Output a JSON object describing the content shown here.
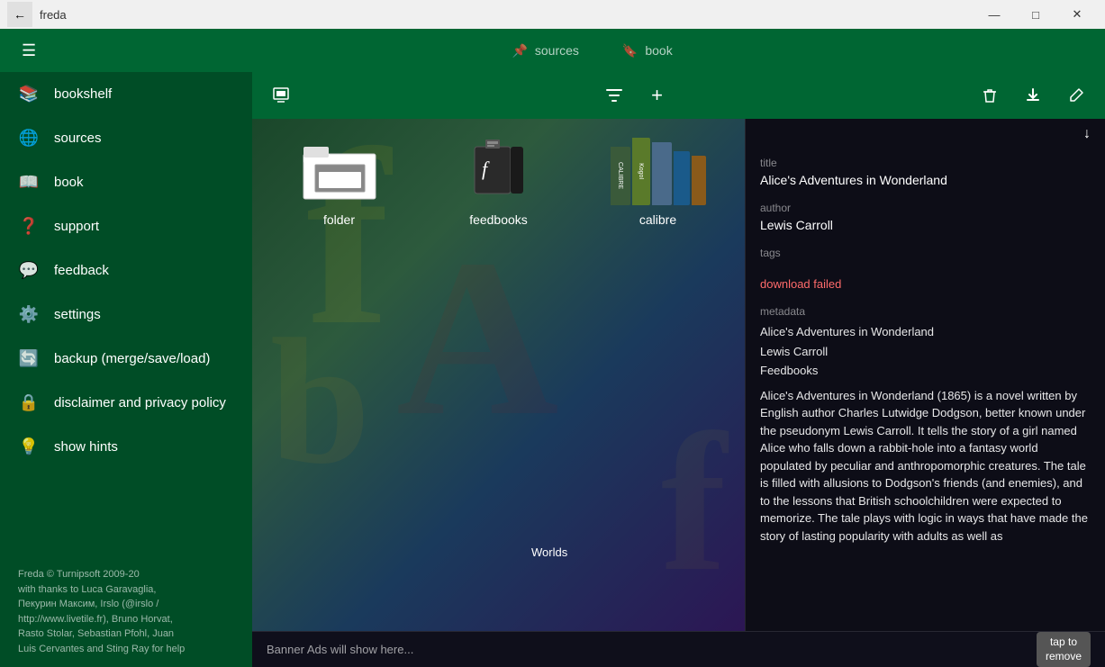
{
  "titlebar": {
    "title": "freda",
    "back_icon": "←",
    "minimize": "—",
    "maximize": "□",
    "close": "✕"
  },
  "topnav": {
    "hamburger": "☰",
    "tabs": [
      {
        "id": "sources",
        "label": "sources",
        "icon": "📌",
        "active": false
      },
      {
        "id": "book",
        "label": "book",
        "icon": "🔖",
        "active": false
      }
    ]
  },
  "sidebar": {
    "items": [
      {
        "id": "bookshelf",
        "label": "bookshelf",
        "icon": "📚"
      },
      {
        "id": "sources",
        "label": "sources",
        "icon": "🌐"
      },
      {
        "id": "book",
        "label": "book",
        "icon": "📖"
      },
      {
        "id": "support",
        "label": "support",
        "icon": "❓"
      },
      {
        "id": "feedback",
        "label": "feedback",
        "icon": "💬"
      },
      {
        "id": "settings",
        "label": "settings",
        "icon": "⚙️"
      },
      {
        "id": "backup",
        "label": "backup (merge/save/load)",
        "icon": "🔄"
      },
      {
        "id": "disclaimer",
        "label": "disclaimer and privacy policy",
        "icon": "🔒"
      },
      {
        "id": "hints",
        "label": "show hints",
        "icon": "💡"
      }
    ],
    "footer": "Freda © Turnipsoft 2009-20\nwith thanks to Luca Garavaglia,\nПекурин Максим, Irslo (@irslo /\nhttp://www.livetile.fr), Bruno Horvat,\nRasto Stolar, Sebastian Pfohl, Juan\nLuis Cervantes and Sting Ray for help"
  },
  "toolbar": {
    "import_icon": "📥",
    "filter_icon": "▼",
    "add_icon": "+",
    "delete_icon": "🗑",
    "download_icon": "⬇",
    "edit_icon": "✏"
  },
  "grid_items": [
    {
      "id": "folder",
      "label": "folder",
      "type": "folder"
    },
    {
      "id": "feedbooks",
      "label": "feedbooks",
      "type": "feedbooks"
    },
    {
      "id": "calibre",
      "label": "calibre",
      "type": "calibre"
    }
  ],
  "worlds_text": "Worlds",
  "right_panel": {
    "download_arrow": "↓",
    "title_label": "title",
    "title_value": "Alice's Adventures in Wonderland",
    "author_label": "author",
    "author_value": "Lewis Carroll",
    "tags_label": "tags",
    "download_failed": "download failed",
    "metadata_label": "metadata",
    "metadata_lines": [
      "Alice's Adventures in Wonderland",
      "Lewis Carroll",
      "Feedbooks",
      "Alice's Adventures in Wonderland (1865) is a novel written by English author Charles Lutwidge Dodgson, better known under the pseudonym Lewis Carroll. It tells the story of a girl named Alice who falls down a rabbit-hole into a fantasy world populated by peculiar and anthropomorphic creatures. The tale is filled with allusions to Dodgson's friends (and enemies), and to the lessons that British schoolchildren were expected to memorize. The tale plays with logic in ways that have made the story of lasting popularity with adults as well as"
    ]
  },
  "banner": {
    "text": "Banner Ads will show here...",
    "remove_label": "tap to\nremove"
  }
}
